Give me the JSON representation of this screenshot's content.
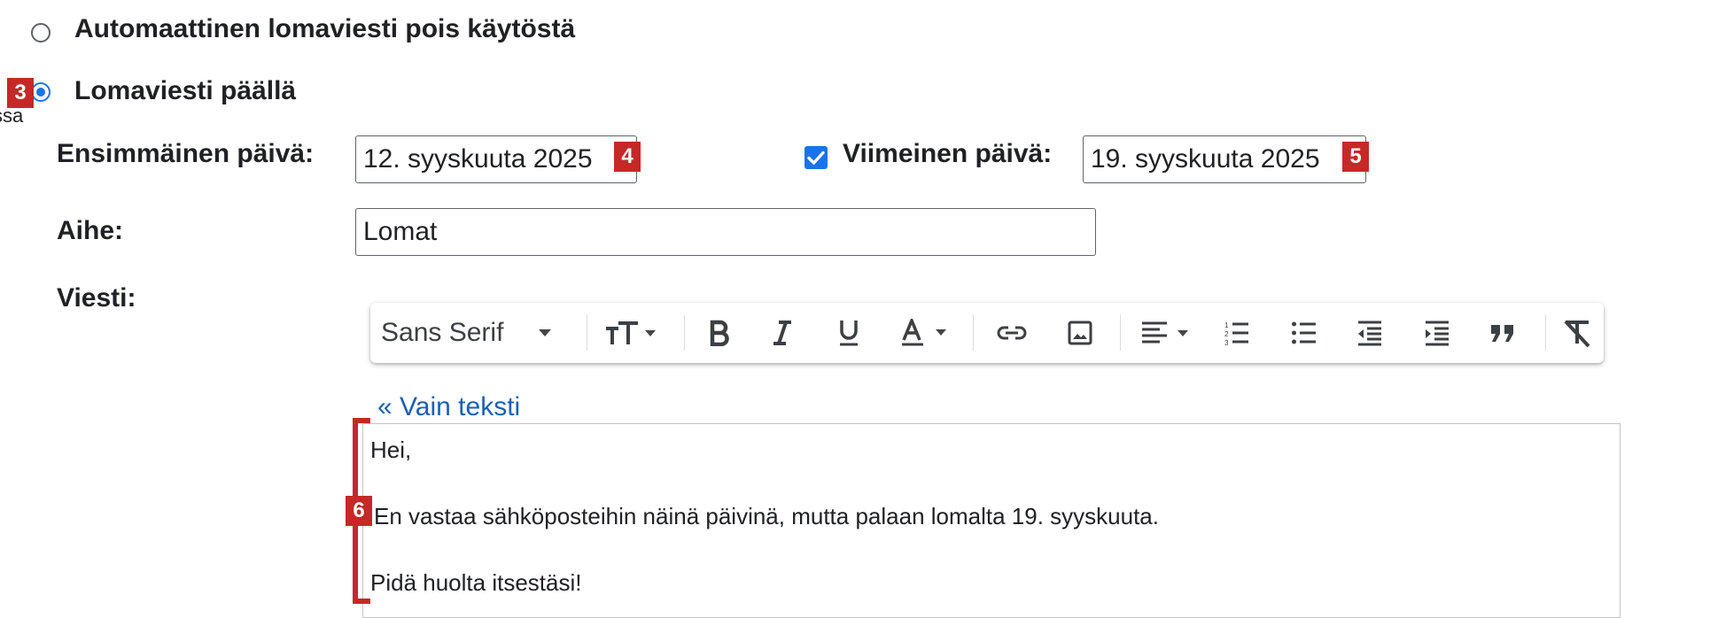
{
  "options": {
    "off_label": "Automaattinen lomaviesti pois käytöstä",
    "on_label": "Lomaviesti päällä",
    "cut_text": "ssa"
  },
  "form": {
    "first_day_label": "Ensimmäinen päivä:",
    "first_day_value": "12. syyskuuta 2025",
    "last_day_label": "Viimeinen päivä:",
    "last_day_value": "19. syyskuuta 2025",
    "last_day_checked": true,
    "subject_label": "Aihe:",
    "subject_value": "Lomat",
    "message_label": "Viesti:"
  },
  "toolbar": {
    "font_name": "Sans Serif",
    "icons": [
      "chevron-down-icon",
      "text-size-icon",
      "bold-icon",
      "italic-icon",
      "underline-icon",
      "text-color-icon",
      "link-icon",
      "image-icon",
      "align-icon",
      "numbered-list-icon",
      "bulleted-list-icon",
      "indent-less-icon",
      "indent-more-icon",
      "quote-icon",
      "remove-formatting-icon"
    ]
  },
  "plain_text_link": "« Vain teksti",
  "message_lines": [
    "Hei,",
    "En vastaa sähköposteihin näinä päivinä, mutta palaan lomalta 19. syyskuuta.",
    "Pidä huolta itsestäsi!"
  ],
  "badges": {
    "b3": "3",
    "b4": "4",
    "b5": "5",
    "b6": "6"
  },
  "colors": {
    "accent": "#1a73e8",
    "badge": "#c62828",
    "link": "#1a5fb4"
  }
}
